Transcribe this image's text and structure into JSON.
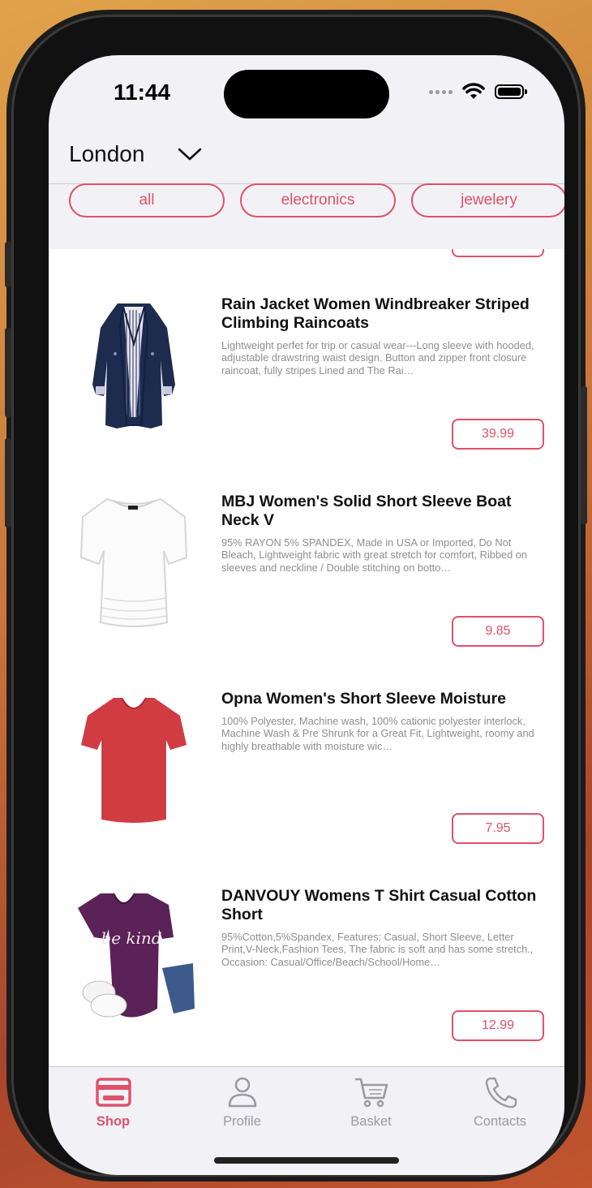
{
  "status_bar": {
    "time": "11:44"
  },
  "header": {
    "city": "London"
  },
  "categories": [
    {
      "label": "all"
    },
    {
      "label": "electronics"
    },
    {
      "label": "jewelery"
    }
  ],
  "products": [
    {
      "title": "Rain Jacket Women Windbreaker Striped Climbing Raincoats",
      "description": "Lightweight perfet for trip or casual wear---Long sleeve with hooded, adjustable drawstring waist design. Button and zipper front closure raincoat, fully stripes Lined and The Rai…",
      "price": "39.99",
      "image_icon": "navy-raincoat-image"
    },
    {
      "title": "MBJ Women's Solid Short Sleeve Boat Neck V",
      "description": "95% RAYON 5% SPANDEX, Made in USA or Imported, Do Not Bleach, Lightweight fabric with great stretch for comfort, Ribbed on sleeves and neckline / Double stitching on botto…",
      "price": "9.85",
      "image_icon": "white-top-image"
    },
    {
      "title": "Opna Women's Short Sleeve Moisture",
      "description": "100% Polyester, Machine wash, 100% cationic polyester interlock, Machine Wash & Pre Shrunk for a Great Fit, Lightweight, roomy and highly breathable with moisture wic…",
      "price": "7.95",
      "image_icon": "red-tshirt-image"
    },
    {
      "title": "DANVOUY Womens T Shirt Casual Cotton Short",
      "description": "95%Cotton,5%Spandex, Features: Casual, Short Sleeve, Letter Print,V-Neck,Fashion Tees, The fabric is soft and has some stretch., Occasion: Casual/Office/Beach/School/Home…",
      "price": "12.99",
      "image_icon": "purple-tshirt-image",
      "image_print": "be kind"
    }
  ],
  "tabbar": {
    "tabs": [
      {
        "label": "Shop",
        "icon": "card-icon",
        "active": true
      },
      {
        "label": "Profile",
        "icon": "person-icon",
        "active": false
      },
      {
        "label": "Basket",
        "icon": "cart-icon",
        "active": false
      },
      {
        "label": "Contacts",
        "icon": "phone-icon",
        "active": false
      }
    ]
  },
  "colors": {
    "accent": "#e0506a",
    "inactive": "#9a9aa0",
    "background": "#f2f2f6"
  }
}
